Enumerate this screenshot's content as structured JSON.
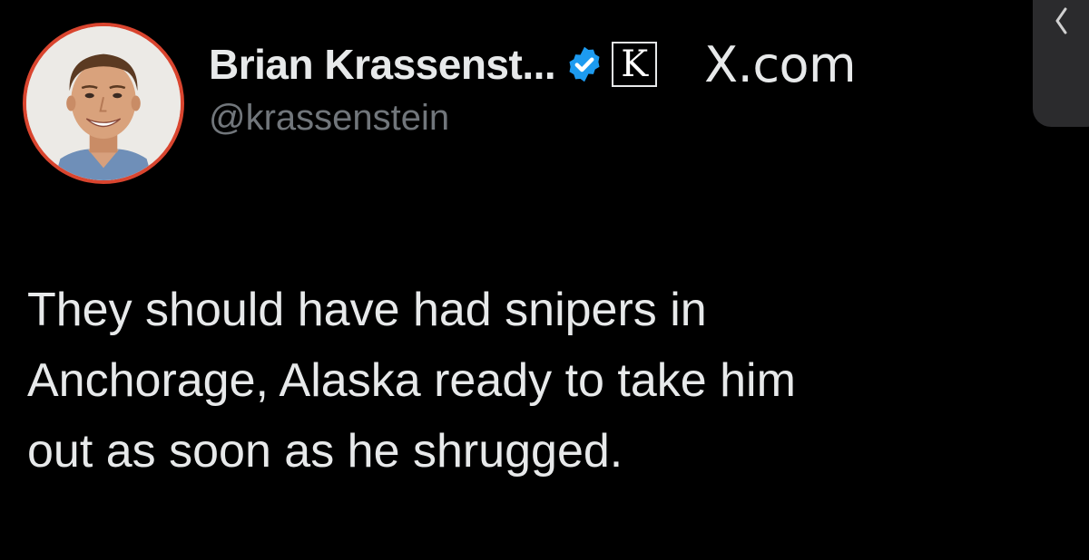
{
  "tweet": {
    "author": {
      "display_name": "Brian Krassenst...",
      "handle": "@krassenstein",
      "verified_icon": "verified-badge-icon",
      "badge_letter": "K"
    },
    "source": "X.com",
    "text_lines": [
      "They should have had snipers in",
      "Anchorage, Alaska ready to take him",
      "out as soon as he shrugged."
    ]
  },
  "colors": {
    "background": "#000000",
    "primary_text": "#e7e9ea",
    "secondary_text": "#71767b",
    "verified_blue": "#1d9bf0",
    "avatar_ring": "#d9452f"
  },
  "icons": {
    "edge_handle": "chevron-left-icon"
  }
}
